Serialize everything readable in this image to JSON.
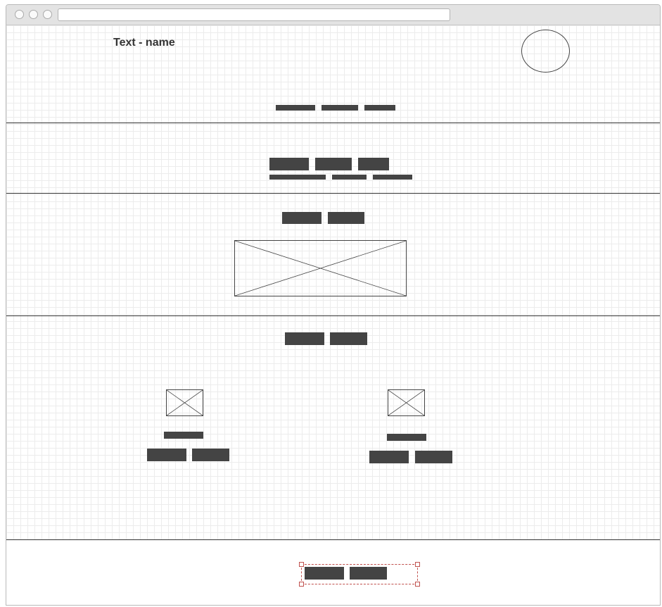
{
  "window": {
    "url": ""
  },
  "header": {
    "title": "Text - name",
    "avatar_icon": "circle-avatar-placeholder"
  },
  "placeholders": {
    "hero_image_icon": "image-placeholder-icon",
    "card_image_icon": "image-placeholder-icon"
  },
  "colors": {
    "block": "#444444",
    "grid": "#ececec",
    "selection": "#c0504d"
  }
}
